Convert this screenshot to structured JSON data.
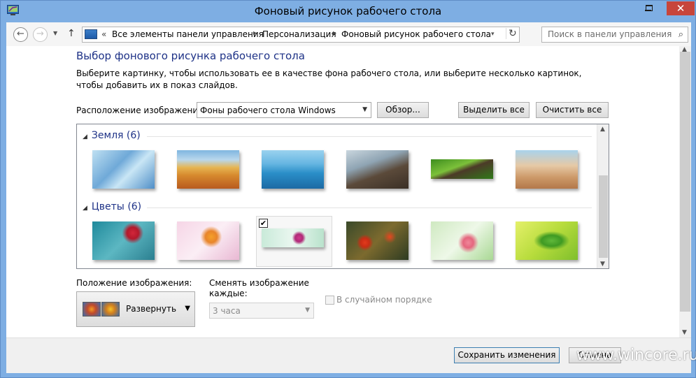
{
  "window": {
    "title": "Фоновый рисунок рабочего стола",
    "icon": "control-panel-icon",
    "close_glyph": "✕"
  },
  "nav": {
    "back_glyph": "←",
    "forward_glyph": "→",
    "history_glyph": "▼",
    "up_glyph": "↑",
    "breadcrumb_overflow": "«",
    "breadcrumbs": [
      "Все элементы панели управления",
      "Персонализация",
      "Фоновый рисунок рабочего стола"
    ],
    "breadcrumb_separator": "▸",
    "address_dropdown_glyph": "▾",
    "refresh_glyph": "↻",
    "search_placeholder": "Поиск в панели управления",
    "search_glyph": "⌕"
  },
  "content": {
    "title": "Выбор фонового рисунка рабочего стола",
    "description": "Выберите картинку, чтобы использовать ее в качестве фона рабочего стола, или выберите несколько картинок, чтобы добавить их в показ слайдов.",
    "location_label": "Расположение изображения:",
    "location_value": "Фоны рабочего стола Windows",
    "browse_button": "Обзор...",
    "select_all_button": "Выделить все",
    "clear_all_button": "Очистить все",
    "groups": [
      {
        "name": "Земля (6)",
        "selected": [
          false,
          false,
          false,
          false,
          false,
          false
        ]
      },
      {
        "name": "Цветы (6)",
        "selected": [
          false,
          false,
          true,
          false,
          false,
          false
        ]
      }
    ],
    "selected_check_glyph": "✔",
    "position_label": "Положение изображения:",
    "position_value": "Развернуть",
    "interval_label_1": "Сменять изображение",
    "interval_label_2": "каждые:",
    "interval_value": "3 часа",
    "shuffle_label": "В случайном порядке"
  },
  "footer": {
    "save_button": "Сохранить изменения",
    "cancel_button": "Отмена",
    "watermark": "www.wincore.ru"
  },
  "colors": {
    "title_text": "#1e3287",
    "frame": "#7eaee3",
    "close_button": "#c7453b"
  }
}
